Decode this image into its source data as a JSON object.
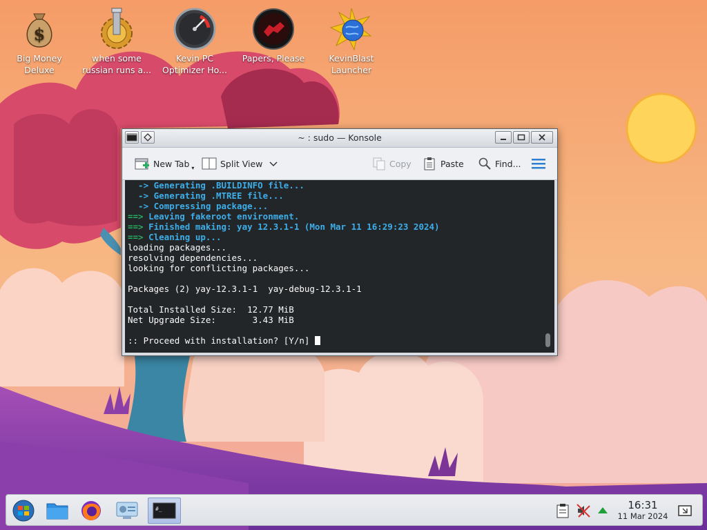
{
  "desktop": {
    "icons": [
      {
        "label_line1": "Big Money",
        "label_line2": "Deluxe",
        "icon": "money-bag-icon"
      },
      {
        "label_line1": "when some",
        "label_line2": "russian runs a...",
        "icon": "gear-pipe-icon"
      },
      {
        "label_line1": "Kevin PC",
        "label_line2": "Optimizer Ho...",
        "icon": "speedometer-icon"
      },
      {
        "label_line1": "Papers, Please",
        "label_line2": "",
        "icon": "papers-please-icon"
      },
      {
        "label_line1": "KevinBlast",
        "label_line2": "Launcher",
        "icon": "star-globe-icon"
      }
    ]
  },
  "window": {
    "title": "~ : sudo — Konsole",
    "toolbar": {
      "new_tab": "New Tab",
      "split_view": "Split View",
      "copy": "Copy",
      "paste": "Paste",
      "find": "Find..."
    },
    "terminal": {
      "lines": [
        {
          "prefix": "  -> ",
          "text": "Generating .BUILDINFO file...",
          "style": "blue"
        },
        {
          "prefix": "  -> ",
          "text": "Generating .MTREE file...",
          "style": "blue"
        },
        {
          "prefix": "  -> ",
          "text": "Compressing package...",
          "style": "blue"
        },
        {
          "prefix": "==> ",
          "text": "Leaving fakeroot environment.",
          "style": "green"
        },
        {
          "prefix": "==> ",
          "text": "Finished making: yay 12.3.1-1 (Mon Mar 11 16:29:23 2024)",
          "style": "green"
        },
        {
          "prefix": "==> ",
          "text": "Cleaning up...",
          "style": "green"
        },
        {
          "prefix": "",
          "text": "loading packages...",
          "style": "plain"
        },
        {
          "prefix": "",
          "text": "resolving dependencies...",
          "style": "plain"
        },
        {
          "prefix": "",
          "text": "looking for conflicting packages...",
          "style": "plain"
        },
        {
          "prefix": "",
          "text": "",
          "style": "plain"
        },
        {
          "prefix": "",
          "text": "Packages (2) yay-12.3.1-1  yay-debug-12.3.1-1",
          "style": "plain"
        },
        {
          "prefix": "",
          "text": "",
          "style": "plain"
        },
        {
          "prefix": "",
          "text": "Total Installed Size:  12.77 MiB",
          "style": "plain"
        },
        {
          "prefix": "",
          "text": "Net Upgrade Size:       3.43 MiB",
          "style": "plain"
        },
        {
          "prefix": "",
          "text": "",
          "style": "plain"
        },
        {
          "prefix": "",
          "text": ":: Proceed with installation? [Y/n] ",
          "style": "prompt"
        }
      ]
    }
  },
  "taskbar": {
    "clock_time": "16:31",
    "clock_date": "11 Mar 2024"
  }
}
